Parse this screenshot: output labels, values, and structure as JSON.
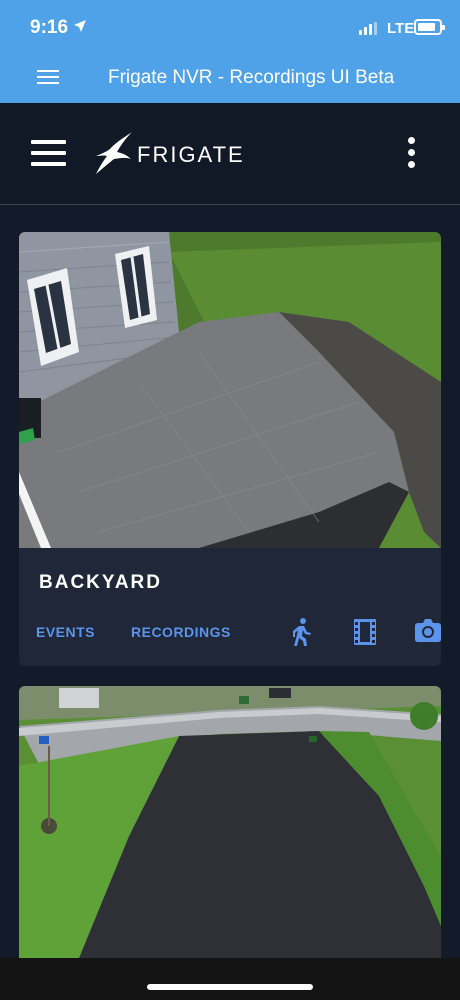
{
  "status_bar": {
    "time": "9:16",
    "network": "LTE",
    "location_icon": "location-arrow-icon",
    "signal_icon": "cellular-signal-icon",
    "battery_icon": "battery-icon"
  },
  "browser": {
    "title": "Frigate NVR - Recordings UI Beta",
    "menu_icon": "hamburger-menu-icon"
  },
  "app_header": {
    "brand": "FRIGATE",
    "menu_icon": "hamburger-menu-icon",
    "logo_icon": "frigate-bird-logo-icon",
    "more_icon": "more-vertical-icon"
  },
  "cameras": [
    {
      "name": "BACKYARD",
      "events_label": "EVENTS",
      "recordings_label": "RECORDINGS",
      "icons": [
        "person-walking-icon",
        "film-strip-icon",
        "camera-icon"
      ]
    },
    {
      "name": "",
      "events_label": "",
      "recordings_label": ""
    }
  ],
  "colors": {
    "status_bar_bg": "#4fa2e8",
    "app_bg": "#131b2a",
    "header_bg": "#111927",
    "card_bg": "#1f2738",
    "accent": "#5b94ea"
  }
}
